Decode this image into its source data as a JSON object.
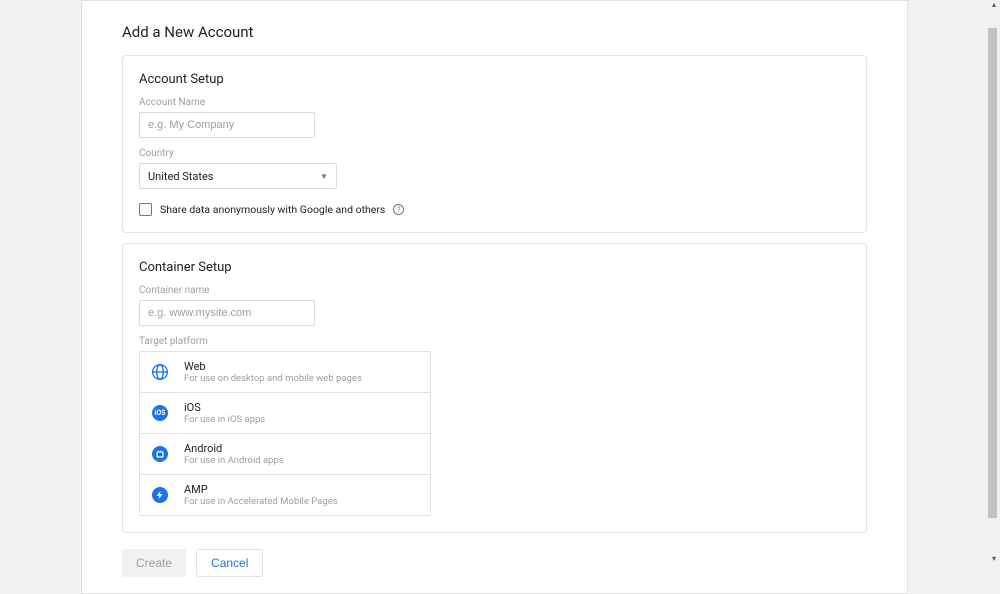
{
  "page_title": "Add a New Account",
  "account_setup": {
    "title": "Account Setup",
    "account_name_label": "Account Name",
    "account_name_placeholder": "e.g. My Company",
    "country_label": "Country",
    "country_value": "United States",
    "share_data_label": "Share data anonymously with Google and others"
  },
  "container_setup": {
    "title": "Container Setup",
    "container_name_label": "Container name",
    "container_name_placeholder": "e.g. www.mysite.com",
    "target_platform_label": "Target platform",
    "platforms": [
      {
        "name": "Web",
        "desc": "For use on desktop and mobile web pages",
        "icon": "globe",
        "color": "#1a73e8"
      },
      {
        "name": "iOS",
        "desc": "For use in iOS apps",
        "icon": "ios",
        "color": "#1a73e8"
      },
      {
        "name": "Android",
        "desc": "For use in Android apps",
        "icon": "android",
        "color": "#1a73e8"
      },
      {
        "name": "AMP",
        "desc": "For use in Accelerated Mobile Pages",
        "icon": "amp",
        "color": "#1a73e8"
      }
    ]
  },
  "buttons": {
    "create": "Create",
    "cancel": "Cancel"
  }
}
